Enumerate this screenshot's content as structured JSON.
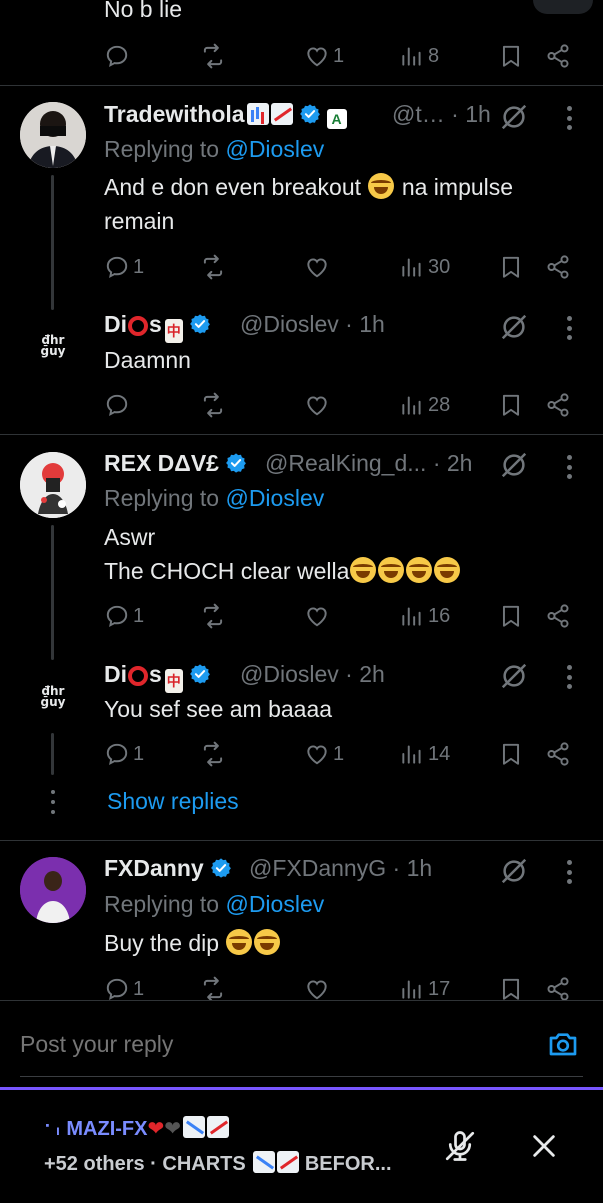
{
  "top_partial": {
    "text": "No b lie",
    "actions": {
      "likes": "1",
      "views": "8"
    }
  },
  "replies": [
    {
      "name": "Tradewithola",
      "handle": "@t…",
      "time": "· 1h",
      "replying_label": "Replying to",
      "replying_to": "@Dioslev",
      "line1": "And e don even breakout",
      "line1b": "na impulse",
      "line2": "remain",
      "actions": {
        "replies": "1",
        "likes": "",
        "views": "30"
      },
      "affiliate_badge": "A"
    },
    {
      "name_a": "Di",
      "name_b": "s",
      "handle": "@Dioslev · 1h",
      "text": "Daamnn",
      "avatar_text_1": "₫hr",
      "avatar_text_2": "guy",
      "actions": {
        "replies": "",
        "likes": "",
        "views": "28"
      }
    },
    {
      "name": "REX DΔV£",
      "handle": "@RealKing_d...",
      "time": "· 2h",
      "replying_label": "Replying to",
      "replying_to": "@Dioslev",
      "line1": "Aswr",
      "line2": "The CHOCH clear wella",
      "actions": {
        "replies": "1",
        "likes": "",
        "views": "16"
      }
    },
    {
      "name_a": "Di",
      "name_b": "s",
      "handle": "@Dioslev · 2h",
      "text": "You sef see am baaaa",
      "avatar_text_1": "₫hr",
      "avatar_text_2": "guy",
      "actions": {
        "replies": "1",
        "likes": "1",
        "views": "14"
      }
    },
    {
      "show_replies": "Show replies"
    },
    {
      "name": "FXDanny",
      "handle": "@FXDannyG",
      "time": "· 1h",
      "replying_label": "Replying to",
      "replying_to": "@Dioslev",
      "text": "Buy the dip",
      "actions": {
        "replies": "1",
        "likes": "",
        "views": "17"
      }
    }
  ],
  "composer": {
    "placeholder": "Post your reply"
  },
  "space": {
    "host": "MAZI-FX",
    "subtitle": "+52 others · CHARTS",
    "subtitle_tail": "BEFOR..."
  },
  "colors": {
    "accent": "#1d9bf0",
    "space_host": "#7a8cff",
    "space_border": "#7856ff"
  }
}
